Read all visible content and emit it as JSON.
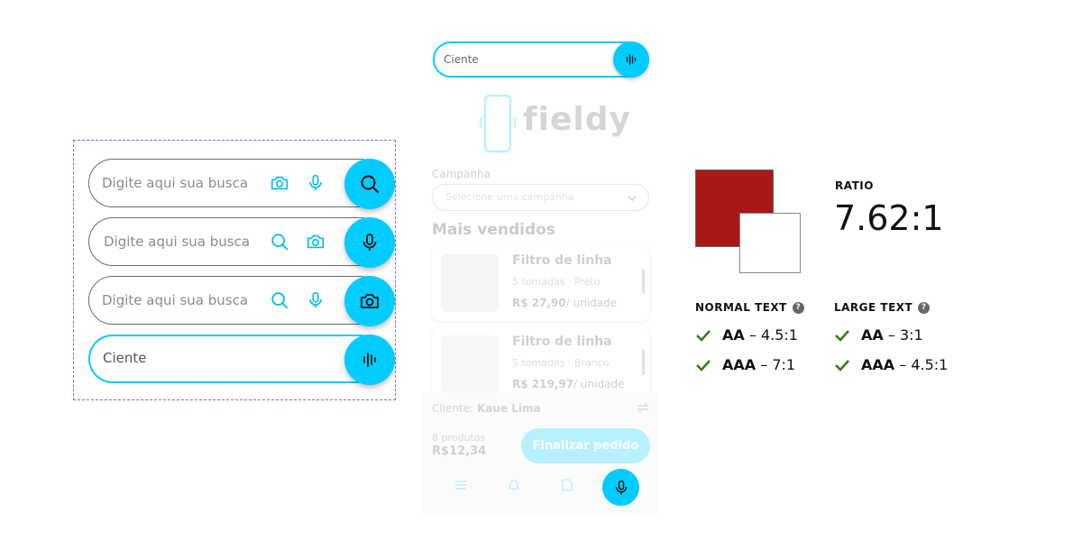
{
  "search_variants": [
    {
      "placeholder": "Digite aqui sua busca",
      "mini_icons": [
        "camera-icon",
        "microphone-icon"
      ],
      "main_icon": "search-icon"
    },
    {
      "placeholder": "Digite aqui sua busca",
      "mini_icons": [
        "search-icon",
        "camera-icon"
      ],
      "main_icon": "microphone-icon"
    },
    {
      "placeholder": "Digite aqui sua busca",
      "mini_icons": [
        "search-icon",
        "microphone-icon"
      ],
      "main_icon": "camera-icon"
    },
    {
      "text": "Ciente",
      "main_icon": "voice-wave-icon"
    }
  ],
  "mockup": {
    "search_text": "Ciente",
    "logo": "fieldy",
    "campaign_label": "Campanha",
    "campaign_placeholder": "Selecione uma campanha",
    "best_sellers_title": "Mais vendidos",
    "products": [
      {
        "name": "Filtro de linha",
        "desc": "5 tomadas · Preto",
        "price": "R$ 27,90",
        "unit": "/ unidade"
      },
      {
        "name": "Filtro de linha",
        "desc": "5 tomadas · Branco",
        "price": "R$ 219,97",
        "unit": "/ unidade"
      }
    ],
    "client_prefix": "Cliente:",
    "client_name": "Kaue Lima",
    "product_count": "8 produtos",
    "total": "R$12,34",
    "finalize_label": "Finalizar pedido"
  },
  "contrast": {
    "colors": {
      "foreground": "#a91717",
      "background": "#ffffff",
      "accent": "#00ccff",
      "check": "#2e7d14"
    },
    "ratio_label": "RATIO",
    "ratio_value": "7.62:1",
    "normal_text": {
      "heading": "NORMAL TEXT",
      "aa_level": "AA",
      "aa_value": "– 4.5:1",
      "aaa_level": "AAA",
      "aaa_value": "– 7:1"
    },
    "large_text": {
      "heading": "LARGE TEXT",
      "aa_level": "AA",
      "aa_value": "– 3:1",
      "aaa_level": "AAA",
      "aaa_value": "– 4.5:1"
    },
    "help_glyph": "?"
  }
}
